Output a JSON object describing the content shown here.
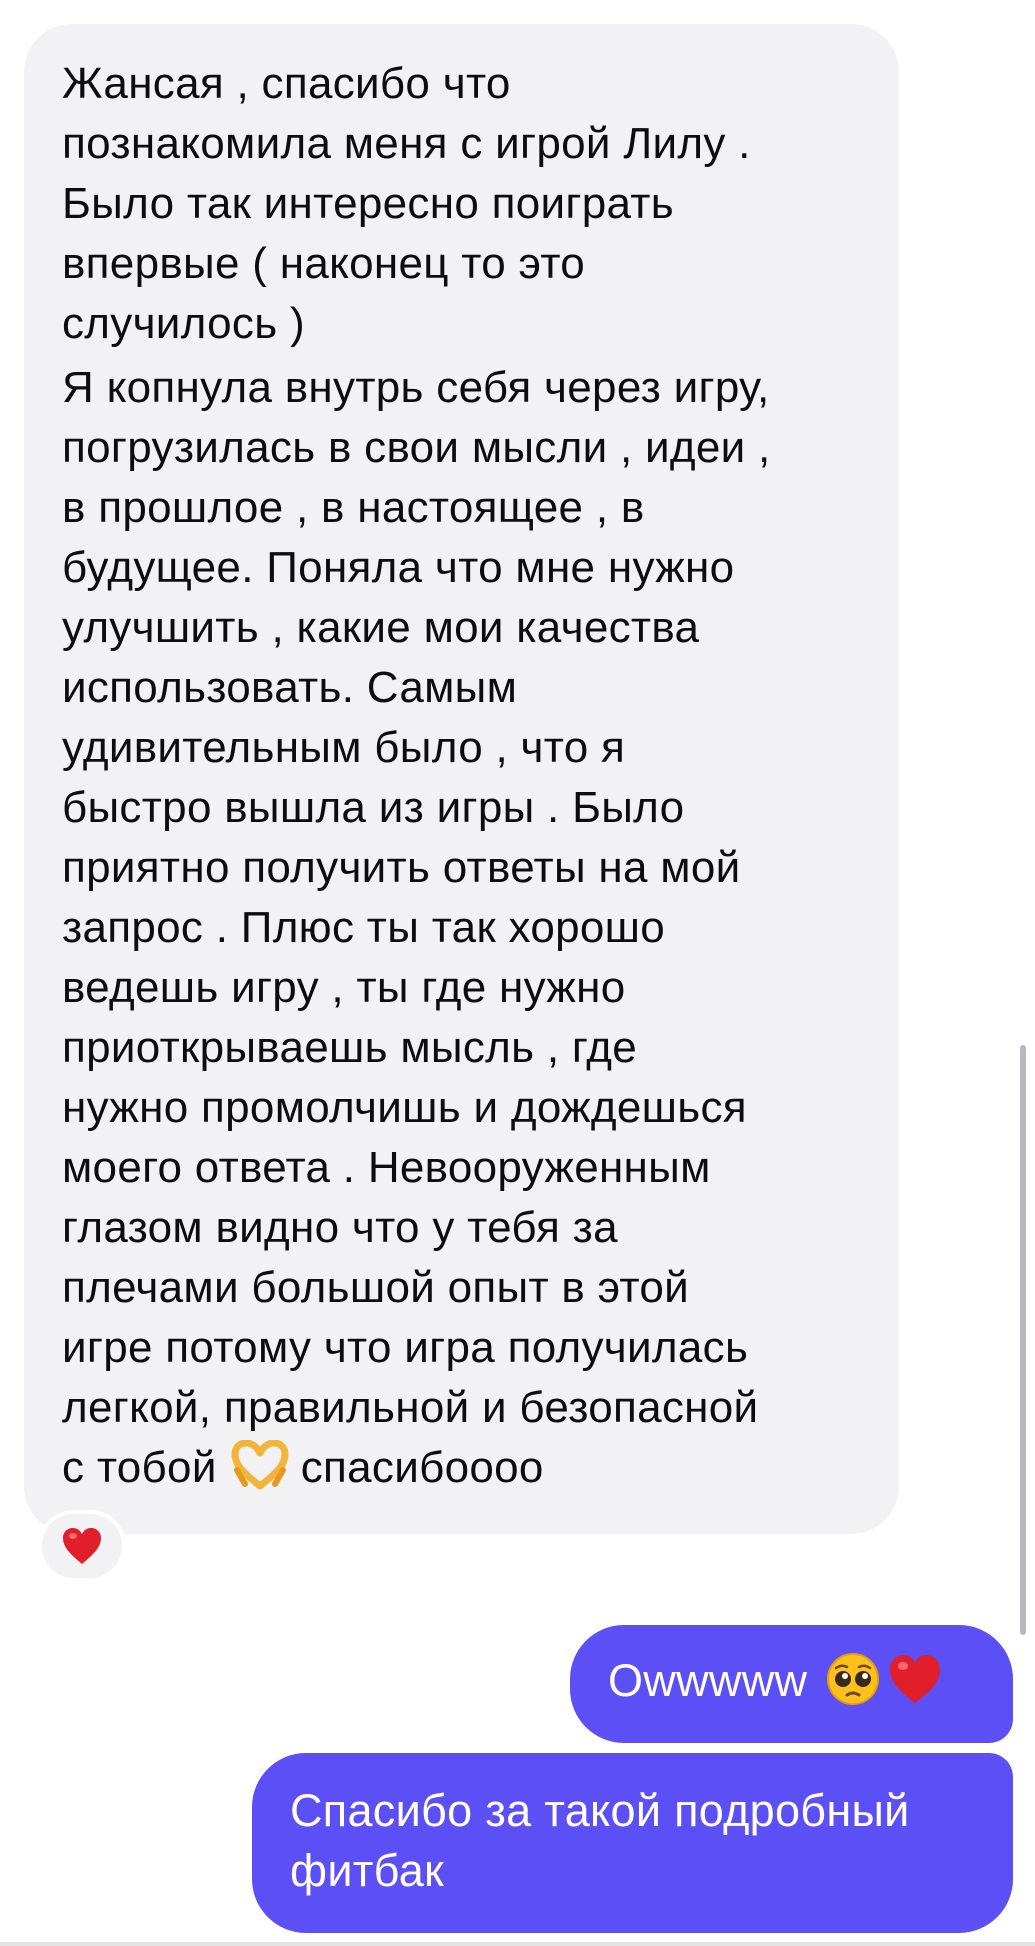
{
  "messages": {
    "incoming": {
      "paragraph_1": "Жансая , спасибо что\nпознакомила меня с игрой Лилу .\nБыло так интересно поиграть\nвпервые ( наконец то это\nслучилось )",
      "paragraph_2": "Я копнула внутрь себя через игру,\nпогрузилась в свои мысли , идеи ,\nв прошлое , в настоящее , в\nбудущее. Поняла что мне нужно\nулучшить , какие мои качества\nиспользовать. Самым\nудивительным было , что я\nбыстро вышла из игры . Было\nприятно получить ответы на мой\nзапрос . Плюс ты так хорошо\nведешь игру , ты где нужно\nприоткрываешь мысль , где\nнужно промолчишь и дождешься\nмоего ответа . Невооруженным\nглазом видно что у тебя за\nплечами большой опыт в этой\nигре потому что игра получилась\nлегкой, правильной и безопасной\nс тобой",
      "closing_text": "спасибоооо",
      "inline_emoji": "heart-hands-icon",
      "reaction_icon": "red-heart-icon"
    },
    "outgoing_1": {
      "text": "Owwwww",
      "emoji_1": "pleading-face-icon",
      "emoji_2": "red-heart-icon"
    },
    "outgoing_2": {
      "text": "Спасибо за такой подробный\nфитбак"
    }
  },
  "colors": {
    "incoming_bubble": "#f2f2f5",
    "outgoing_bubble": "#5b4ff5",
    "heart": "#e01f2b"
  }
}
